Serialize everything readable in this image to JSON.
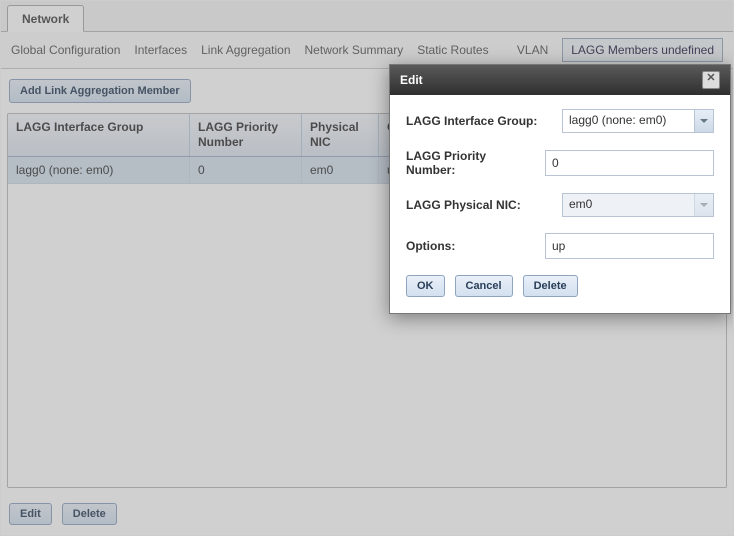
{
  "tab": {
    "label": "Network"
  },
  "subnav": {
    "items": [
      "Global Configuration",
      "Interfaces",
      "Link Aggregation",
      "Network Summary",
      "Static Routes",
      "VLAN"
    ],
    "active_box": "LAGG Members undefined"
  },
  "toolbar": {
    "add_member": "Add Link Aggregation Member"
  },
  "grid": {
    "headers": {
      "group": "LAGG Interface Group",
      "priority": "LAGG Priority Number",
      "nic": "Physical NIC",
      "options": "Options"
    },
    "rows": [
      {
        "group": "lagg0 (none: em0)",
        "priority": "0",
        "nic": "em0",
        "options": "up"
      }
    ]
  },
  "footer": {
    "edit": "Edit",
    "delete": "Delete"
  },
  "dialog": {
    "title": "Edit",
    "fields": {
      "group_label": "LAGG Interface Group:",
      "group_value": "lagg0 (none: em0)",
      "priority_label": "LAGG Priority Number:",
      "priority_value": "0",
      "nic_label": "LAGG Physical NIC:",
      "nic_value": "em0",
      "options_label": "Options:",
      "options_value": "up"
    },
    "buttons": {
      "ok": "OK",
      "cancel": "Cancel",
      "delete": "Delete"
    }
  }
}
